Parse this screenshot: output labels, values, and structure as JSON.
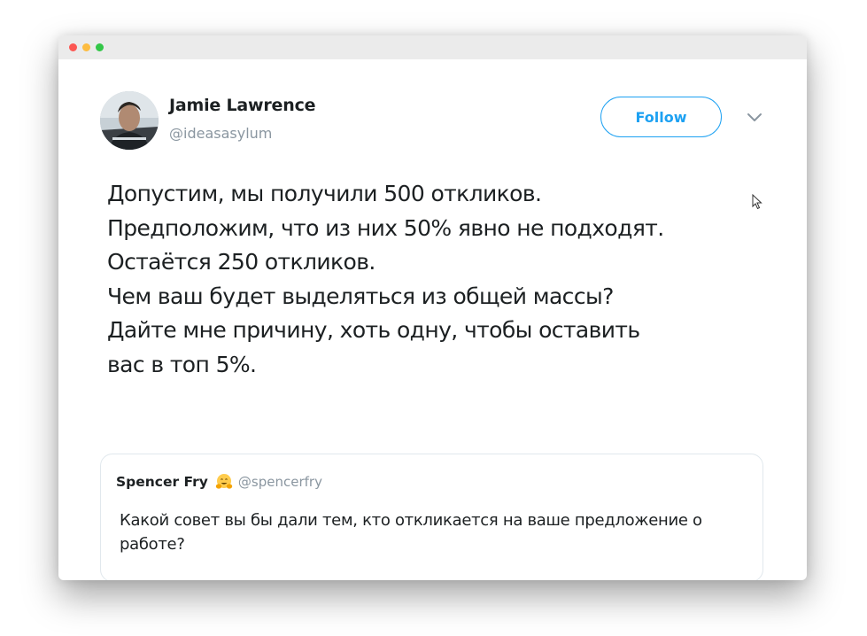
{
  "window": {
    "controls": [
      "close",
      "minimize",
      "zoom"
    ]
  },
  "tweet": {
    "author": {
      "name": "Jamie Lawrence",
      "handle": "@ideasasylum",
      "avatar_icon": "user-avatar-photo"
    },
    "follow_label": "Follow",
    "menu_icon": "chevron-down-icon",
    "body_lines": [
      "Допустим, мы получили 500 откликов.",
      "Предположим, что из них 50% явно не подходят.",
      "Остаётся 250 откликов.",
      "Чем ваш будет выделяться из общей массы?",
      "Дайте мне причину, хоть одну, чтобы оставить",
      "вас в топ 5%."
    ]
  },
  "quoted_tweet": {
    "author_name": "Spencer Fry",
    "emoji_icon": "hugging-face-emoji",
    "handle": "@spencerfry",
    "text": "Какой совет вы бы дали тем, кто откликается на ваше предложение о работе?"
  },
  "colors": {
    "accent": "#1da1f2",
    "text": "#1c2022",
    "muted": "#8a96a0",
    "border": "#e1e8ed"
  }
}
